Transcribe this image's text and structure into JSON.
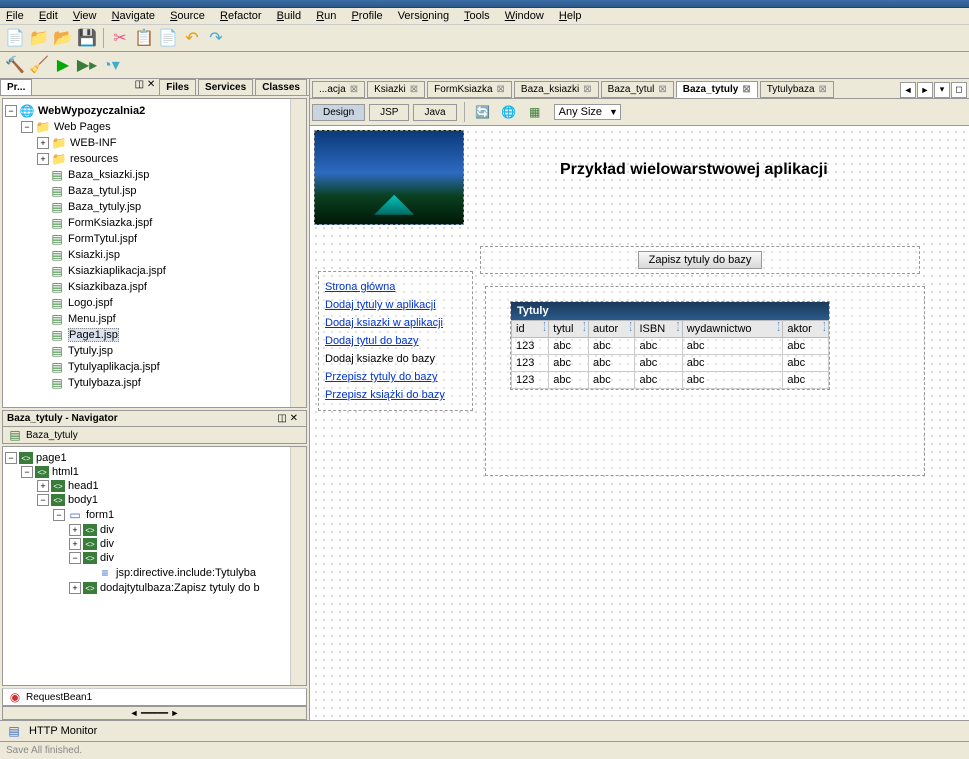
{
  "menu": [
    "File",
    "Edit",
    "View",
    "Navigate",
    "Source",
    "Refactor",
    "Build",
    "Run",
    "Profile",
    "Versioning",
    "Tools",
    "Window",
    "Help"
  ],
  "left_panel": {
    "tabs": [
      "Pr...",
      "Files",
      "Services",
      "Classes"
    ],
    "project": "WebWypozyczalnia2",
    "webpages": "Web Pages",
    "folders": [
      "WEB-INF",
      "resources"
    ],
    "files": [
      "Baza_ksiazki.jsp",
      "Baza_tytul.jsp",
      "Baza_tytuly.jsp",
      "FormKsiazka.jspf",
      "FormTytul.jspf",
      "Ksiazki.jsp",
      "Ksiazkiaplikacja.jspf",
      "Ksiazkibaza.jspf",
      "Logo.jspf",
      "Menu.jspf",
      "Page1.jsp",
      "Tytuly.jsp",
      "Tytulyaplikacja.jspf",
      "Tytulybaza.jspf"
    ],
    "selected": "Page1.jsp"
  },
  "navigator": {
    "title": "Baza_tytuly - Navigator",
    "root": "Baza_tytuly",
    "nodes": [
      "page1",
      "html1",
      "head1",
      "body1",
      "form1"
    ],
    "divs": [
      "div",
      "div",
      "div"
    ],
    "include": "jsp:directive.include:Tytulyba",
    "action": "dodajtytulbaza:Zapisz tytuly do b",
    "bean": "RequestBean1"
  },
  "editor": {
    "tabs": [
      "...acja",
      "Ksiazki",
      "FormKsiazka",
      "Baza_ksiazki",
      "Baza_tytul",
      "Baza_tytuly",
      "Tytulybaza"
    ],
    "active": "Baza_tytuly",
    "modes": [
      "Design",
      "JSP",
      "Java"
    ],
    "size_select": "Any Size"
  },
  "preview": {
    "heading": "Przykład wielowarstwowej aplikacji",
    "button": "Zapisz tytuly do bazy",
    "nav": [
      "Strona główna",
      "Dodaj tytuly w aplikacji",
      "Dodaj ksiazki w aplikacji",
      "Dodaj tytul do bazy",
      "Dodaj ksiazke do bazy",
      "Przepisz tytuly do bazy",
      "Przepisz książki do bazy"
    ],
    "nav_nolink_index": 4,
    "table": {
      "caption": "Tytuly",
      "headers": [
        "id",
        "tytul",
        "autor",
        "ISBN",
        "wydawnictwo",
        "aktor"
      ],
      "rows": [
        [
          "123",
          "abc",
          "abc",
          "abc",
          "abc",
          "abc"
        ],
        [
          "123",
          "abc",
          "abc",
          "abc",
          "abc",
          "abc"
        ],
        [
          "123",
          "abc",
          "abc",
          "abc",
          "abc",
          "abc"
        ]
      ]
    }
  },
  "bottom": {
    "http_monitor": "HTTP Monitor"
  },
  "status": "Save All finished."
}
